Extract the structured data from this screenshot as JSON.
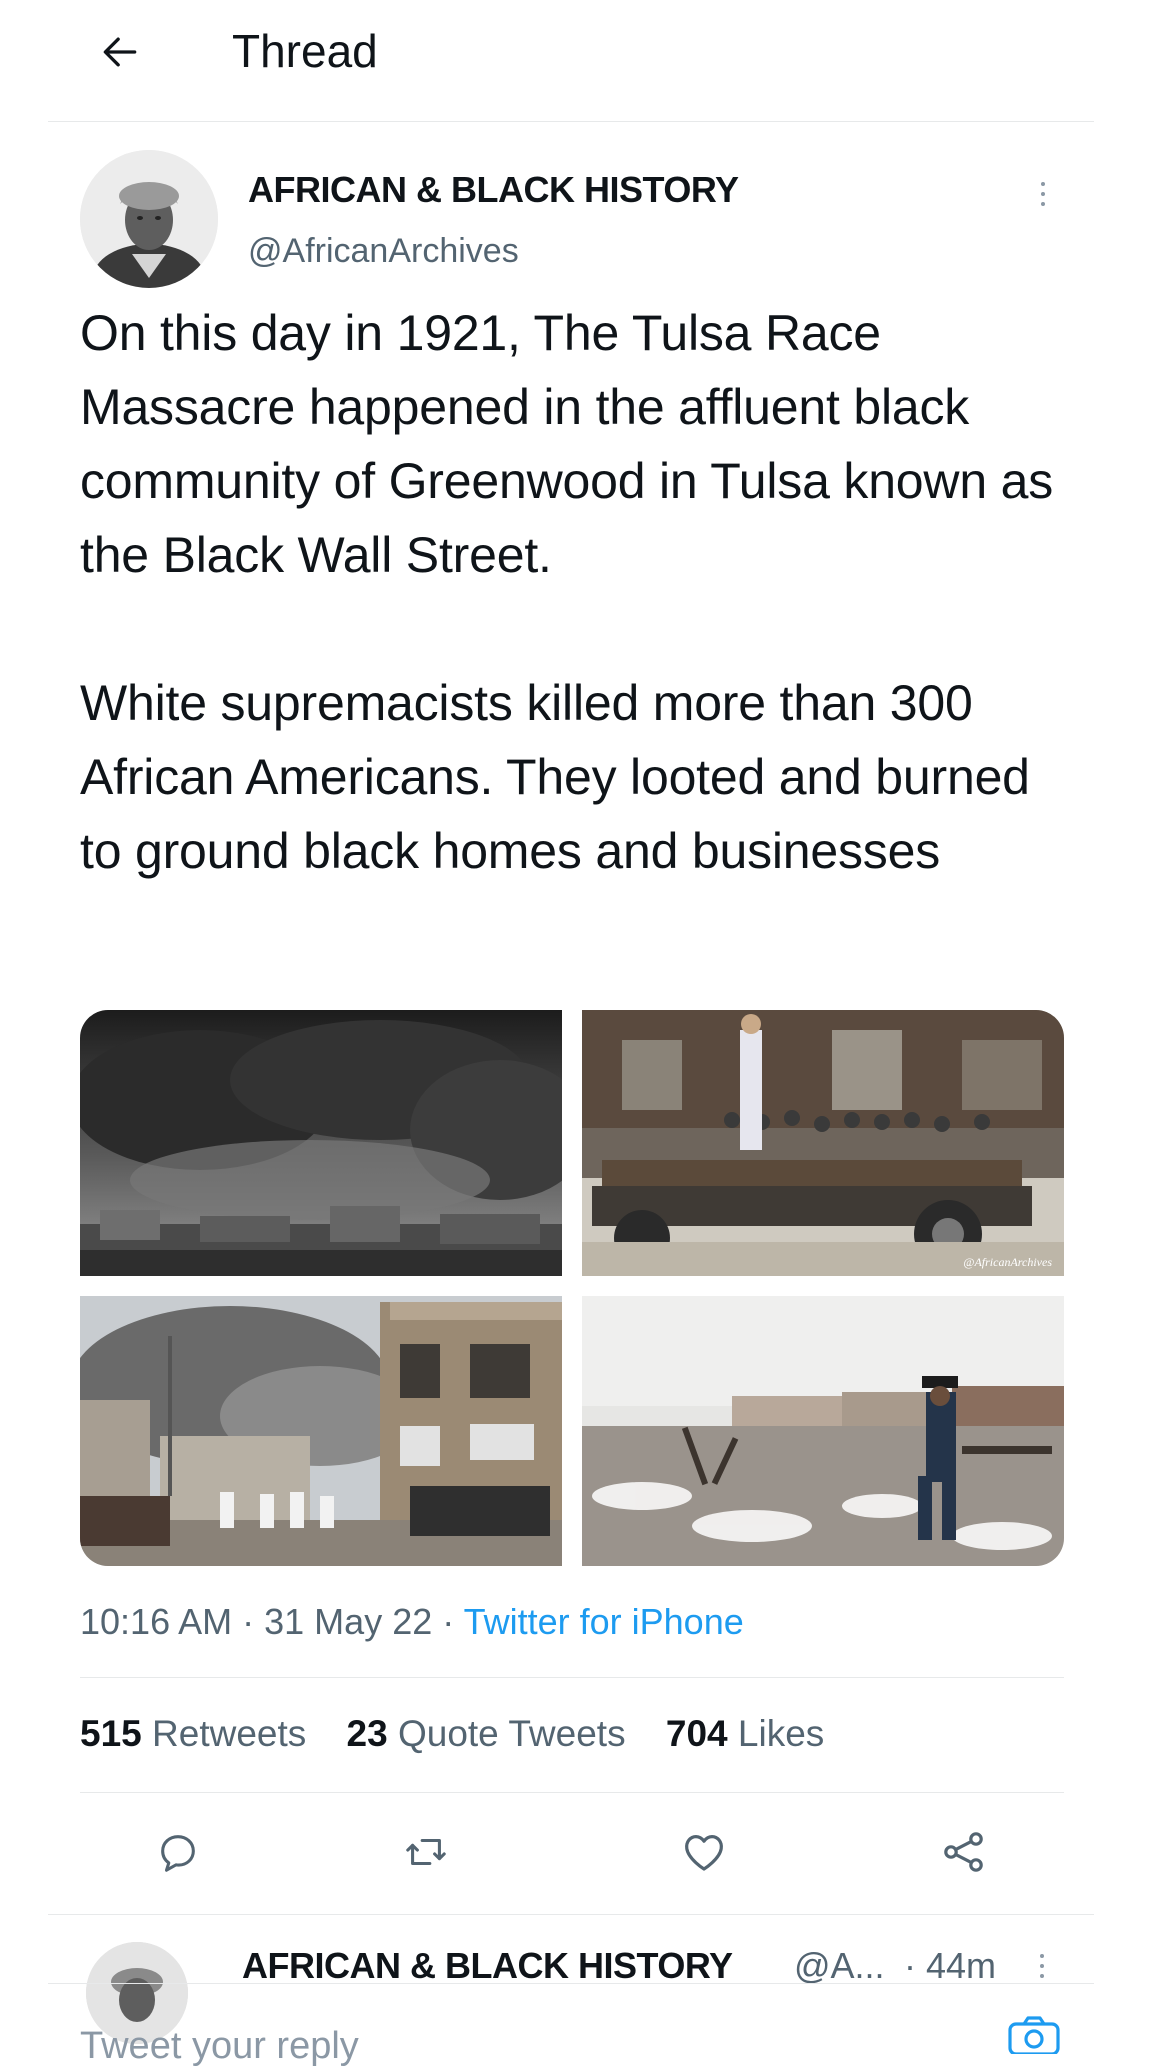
{
  "header": {
    "title": "Thread",
    "back_icon": "arrow-left-icon"
  },
  "tweet": {
    "author_name": "AFRICAN & BLACK HISTORY",
    "handle": "@AfricanArchives",
    "text": "On this day in 1921, The Tulsa Race Massacre happened in the affluent black community of Greenwood in Tulsa known as the Black Wall Street.\n\nWhite supremacists killed more than 300 African Americans. They looted and burned to ground black homes and businesses",
    "media_watermark": "@AfricanArchives",
    "time": "10:16 AM",
    "date": "31 May 22",
    "source": "Twitter for iPhone",
    "separator": "·"
  },
  "stats": {
    "retweets_count": "515",
    "retweets_label": "Retweets",
    "quotes_count": "23",
    "quotes_label": "Quote Tweets",
    "likes_count": "704",
    "likes_label": "Likes"
  },
  "actions": [
    "reply-icon",
    "retweet-icon",
    "like-icon",
    "share-icon"
  ],
  "reply": {
    "author_name": "AFRICAN & BLACK HISTORY",
    "handle": "@A...",
    "time": "· 44m"
  },
  "composer": {
    "placeholder": "Tweet your reply"
  },
  "colors": {
    "text": "#0f1419",
    "secondary": "#536471",
    "link": "#1d9bf0",
    "divider": "#e7e9ea"
  }
}
